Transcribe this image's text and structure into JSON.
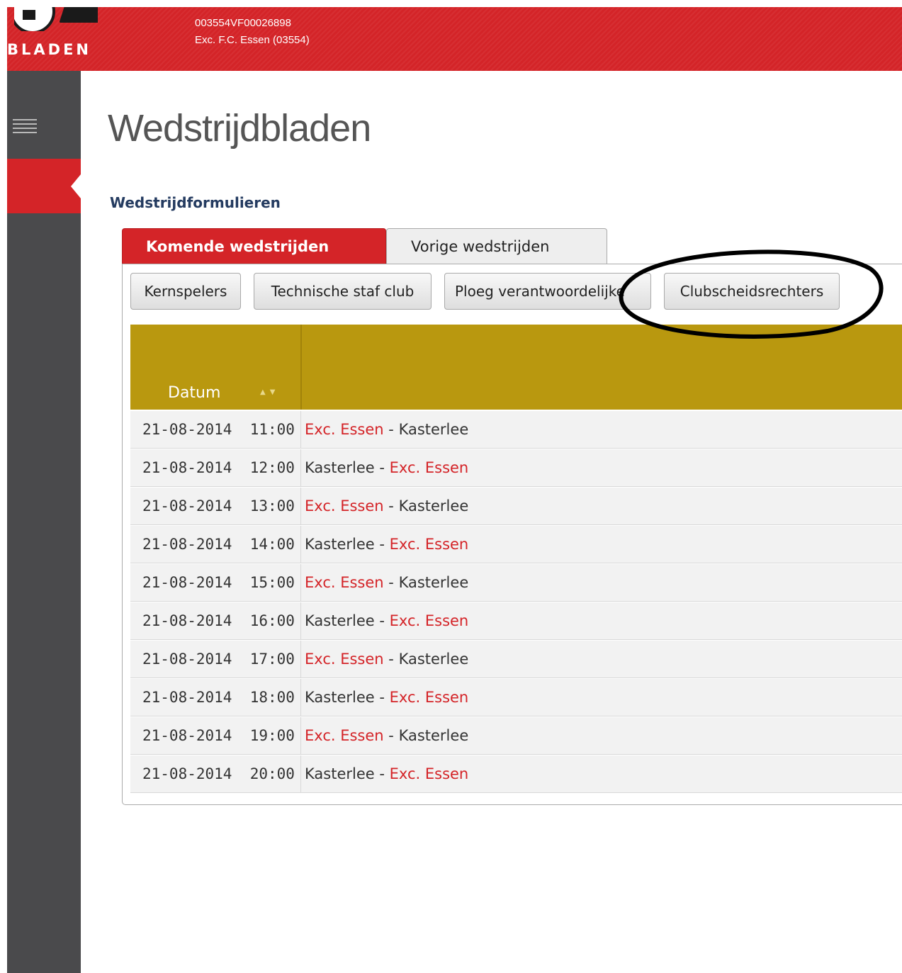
{
  "header": {
    "logo_text": "BLADEN",
    "account_code": "003554VF00026898",
    "club_name": "Exc. F.C. Essen (03554)"
  },
  "sidebar": {
    "menu_icon": "hamburger-icon"
  },
  "page": {
    "title": "Wedstrijdbladen",
    "section_title": "Wedstrijdformulieren"
  },
  "tabs": [
    {
      "label": "Komende wedstrijden",
      "active": true
    },
    {
      "label": "Vorige wedstrijden",
      "active": false
    }
  ],
  "toolbar": {
    "buttons": [
      {
        "label": "Kernspelers"
      },
      {
        "label": "Technische staf club"
      },
      {
        "label": "Ploeg verantwoordelijke"
      },
      {
        "label": "Clubscheidsrechters"
      }
    ]
  },
  "grid": {
    "columns": [
      "Datum",
      ""
    ],
    "sort_icon": "sort-arrows-icon",
    "rows": [
      {
        "date": "21-08-2014",
        "time": "11:00",
        "home": "Exc. Essen",
        "separator": "-",
        "away": "Kasterlee",
        "club_first": true
      },
      {
        "date": "21-08-2014",
        "time": "12:00",
        "home": "Kasterlee",
        "separator": "-",
        "away": "Exc. Essen",
        "club_first": false
      },
      {
        "date": "21-08-2014",
        "time": "13:00",
        "home": "Exc. Essen",
        "separator": "-",
        "away": "Kasterlee",
        "club_first": true
      },
      {
        "date": "21-08-2014",
        "time": "14:00",
        "home": "Kasterlee",
        "separator": "-",
        "away": "Exc. Essen",
        "club_first": false
      },
      {
        "date": "21-08-2014",
        "time": "15:00",
        "home": "Exc. Essen",
        "separator": "-",
        "away": "Kasterlee",
        "club_first": true
      },
      {
        "date": "21-08-2014",
        "time": "16:00",
        "home": "Kasterlee",
        "separator": "-",
        "away": "Exc. Essen",
        "club_first": false
      },
      {
        "date": "21-08-2014",
        "time": "17:00",
        "home": "Exc. Essen",
        "separator": "-",
        "away": "Kasterlee",
        "club_first": true
      },
      {
        "date": "21-08-2014",
        "time": "18:00",
        "home": "Kasterlee",
        "separator": "-",
        "away": "Exc. Essen",
        "club_first": false
      },
      {
        "date": "21-08-2014",
        "time": "19:00",
        "home": "Exc. Essen",
        "separator": "-",
        "away": "Kasterlee",
        "club_first": true
      },
      {
        "date": "21-08-2014",
        "time": "20:00",
        "home": "Kasterlee",
        "separator": "-",
        "away": "Exc. Essen",
        "club_first": false
      }
    ]
  },
  "colors": {
    "brand_red": "#d42428",
    "header_gold": "#b9980f",
    "sidebar_gray": "#4a4a4c",
    "title_navy": "#243b60"
  }
}
